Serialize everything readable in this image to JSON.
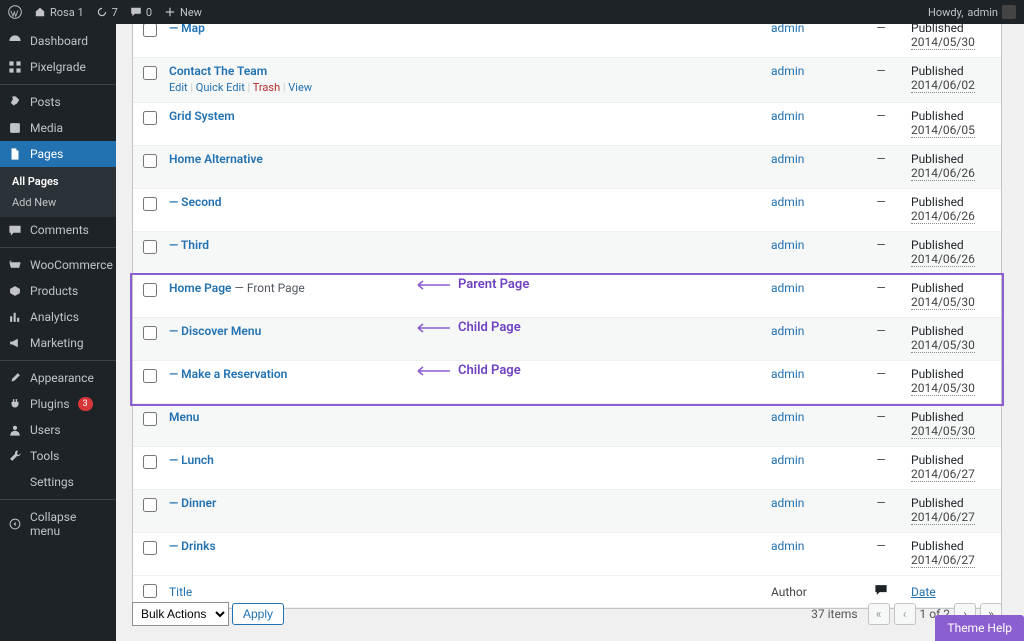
{
  "adminbar": {
    "site_name": "Rosa 1",
    "updates_count": "7",
    "comments_count": "0",
    "new_label": "New",
    "howdy_prefix": "Howdy, ",
    "username": "admin"
  },
  "sidebar": {
    "dashboard": "Dashboard",
    "pixelgrade": "Pixelgrade",
    "posts": "Posts",
    "media": "Media",
    "pages": "Pages",
    "all_pages": "All Pages",
    "add_new": "Add New",
    "comments": "Comments",
    "woocommerce": "WooCommerce",
    "products": "Products",
    "analytics": "Analytics",
    "marketing": "Marketing",
    "appearance": "Appearance",
    "plugins": "Plugins",
    "plugins_badge": "3",
    "users": "Users",
    "tools": "Tools",
    "settings": "Settings",
    "collapse": "Collapse menu"
  },
  "annotations": {
    "parent_page": "Parent Page",
    "child_page_1": "Child Page",
    "child_page_2": "Child Page"
  },
  "rows": [
    {
      "title": "— Map",
      "suffix": "",
      "actions": false,
      "author": "admin",
      "comments": "—",
      "status": "Published",
      "date": "2014/05/30",
      "alt": false
    },
    {
      "title": "Contact The Team",
      "suffix": "",
      "actions": true,
      "author": "admin",
      "comments": "—",
      "status": "Published",
      "date": "2014/06/02",
      "alt": true
    },
    {
      "title": "Grid System",
      "suffix": "",
      "actions": false,
      "author": "admin",
      "comments": "—",
      "status": "Published",
      "date": "2014/06/05",
      "alt": false
    },
    {
      "title": "Home Alternative",
      "suffix": "",
      "actions": false,
      "author": "admin",
      "comments": "—",
      "status": "Published",
      "date": "2014/06/26",
      "alt": true
    },
    {
      "title": "— Second",
      "suffix": "",
      "actions": false,
      "author": "admin",
      "comments": "—",
      "status": "Published",
      "date": "2014/06/26",
      "alt": false
    },
    {
      "title": "— Third",
      "suffix": "",
      "actions": false,
      "author": "admin",
      "comments": "—",
      "status": "Published",
      "date": "2014/06/26",
      "alt": true
    },
    {
      "title": "Home Page",
      "suffix": " — Front Page",
      "actions": false,
      "author": "admin",
      "comments": "—",
      "status": "Published",
      "date": "2014/05/30",
      "alt": false,
      "anno": "parent"
    },
    {
      "title": "— Discover Menu",
      "suffix": "",
      "actions": false,
      "author": "admin",
      "comments": "—",
      "status": "Published",
      "date": "2014/05/30",
      "alt": true,
      "anno": "child1"
    },
    {
      "title": "— Make a Reservation",
      "suffix": "",
      "actions": false,
      "author": "admin",
      "comments": "—",
      "status": "Published",
      "date": "2014/05/30",
      "alt": false,
      "anno": "child2"
    },
    {
      "title": "Menu",
      "suffix": "",
      "actions": false,
      "author": "admin",
      "comments": "—",
      "status": "Published",
      "date": "2014/05/30",
      "alt": true
    },
    {
      "title": "— Lunch",
      "suffix": "",
      "actions": false,
      "author": "admin",
      "comments": "—",
      "status": "Published",
      "date": "2014/06/27",
      "alt": false
    },
    {
      "title": "— Dinner",
      "suffix": "",
      "actions": false,
      "author": "admin",
      "comments": "—",
      "status": "Published",
      "date": "2014/06/27",
      "alt": true
    },
    {
      "title": "— Drinks",
      "suffix": "",
      "actions": false,
      "author": "admin",
      "comments": "—",
      "status": "Published",
      "date": "2014/06/27",
      "alt": false
    }
  ],
  "row_actions": {
    "edit": "Edit",
    "quick": "Quick Edit",
    "trash": "Trash",
    "view": "View"
  },
  "foot_header": {
    "title": "Title",
    "author": "Author",
    "date": "Date"
  },
  "bottom": {
    "bulk_label": "Bulk Actions",
    "apply": "Apply",
    "items_label": "37 items",
    "page_of": "1 of 2"
  },
  "theme_help": "Theme Help"
}
